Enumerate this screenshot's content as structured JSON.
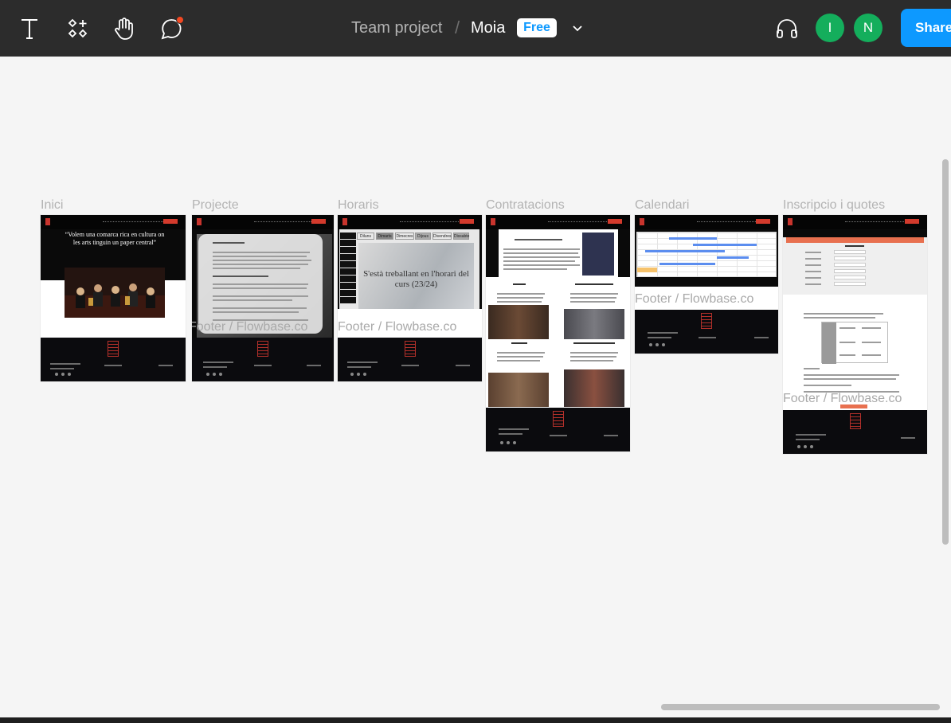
{
  "toolbar": {
    "tools": [
      "text-tool",
      "components-tool",
      "hand-tool",
      "comment-tool"
    ],
    "breadcrumb": {
      "team": "Team project",
      "separator": "/",
      "file": "Moia"
    },
    "plan_badge": "Free",
    "avatars": [
      {
        "initial": "I",
        "color": "#14ae5c"
      },
      {
        "initial": "N",
        "color": "#14ae5c"
      }
    ],
    "share_label": "Share",
    "accent": "#0d99ff"
  },
  "canvas": {
    "frames": [
      {
        "label": "Inici",
        "quote": "“Volem una comarca rica en cultura on les arts tinguin un paper central”"
      },
      {
        "label": "Projecte",
        "overlay": "Footer / Flowbase.co"
      },
      {
        "label": "Horaris",
        "caption": "S'està treballant en l'horari del curs (23/24)",
        "overlay": "Footer / Flowbase.co",
        "tabs": [
          "Diluns",
          "Dimarts",
          "Dimecres",
          "Dijous",
          "Divendres",
          "Dissabte"
        ]
      },
      {
        "label": "Contratacions"
      },
      {
        "label": "Calendari",
        "overlay": "Footer / Flowbase.co"
      },
      {
        "label": "Inscripcio i quotes",
        "overlay": "Footer / Flowbase.co"
      }
    ]
  }
}
